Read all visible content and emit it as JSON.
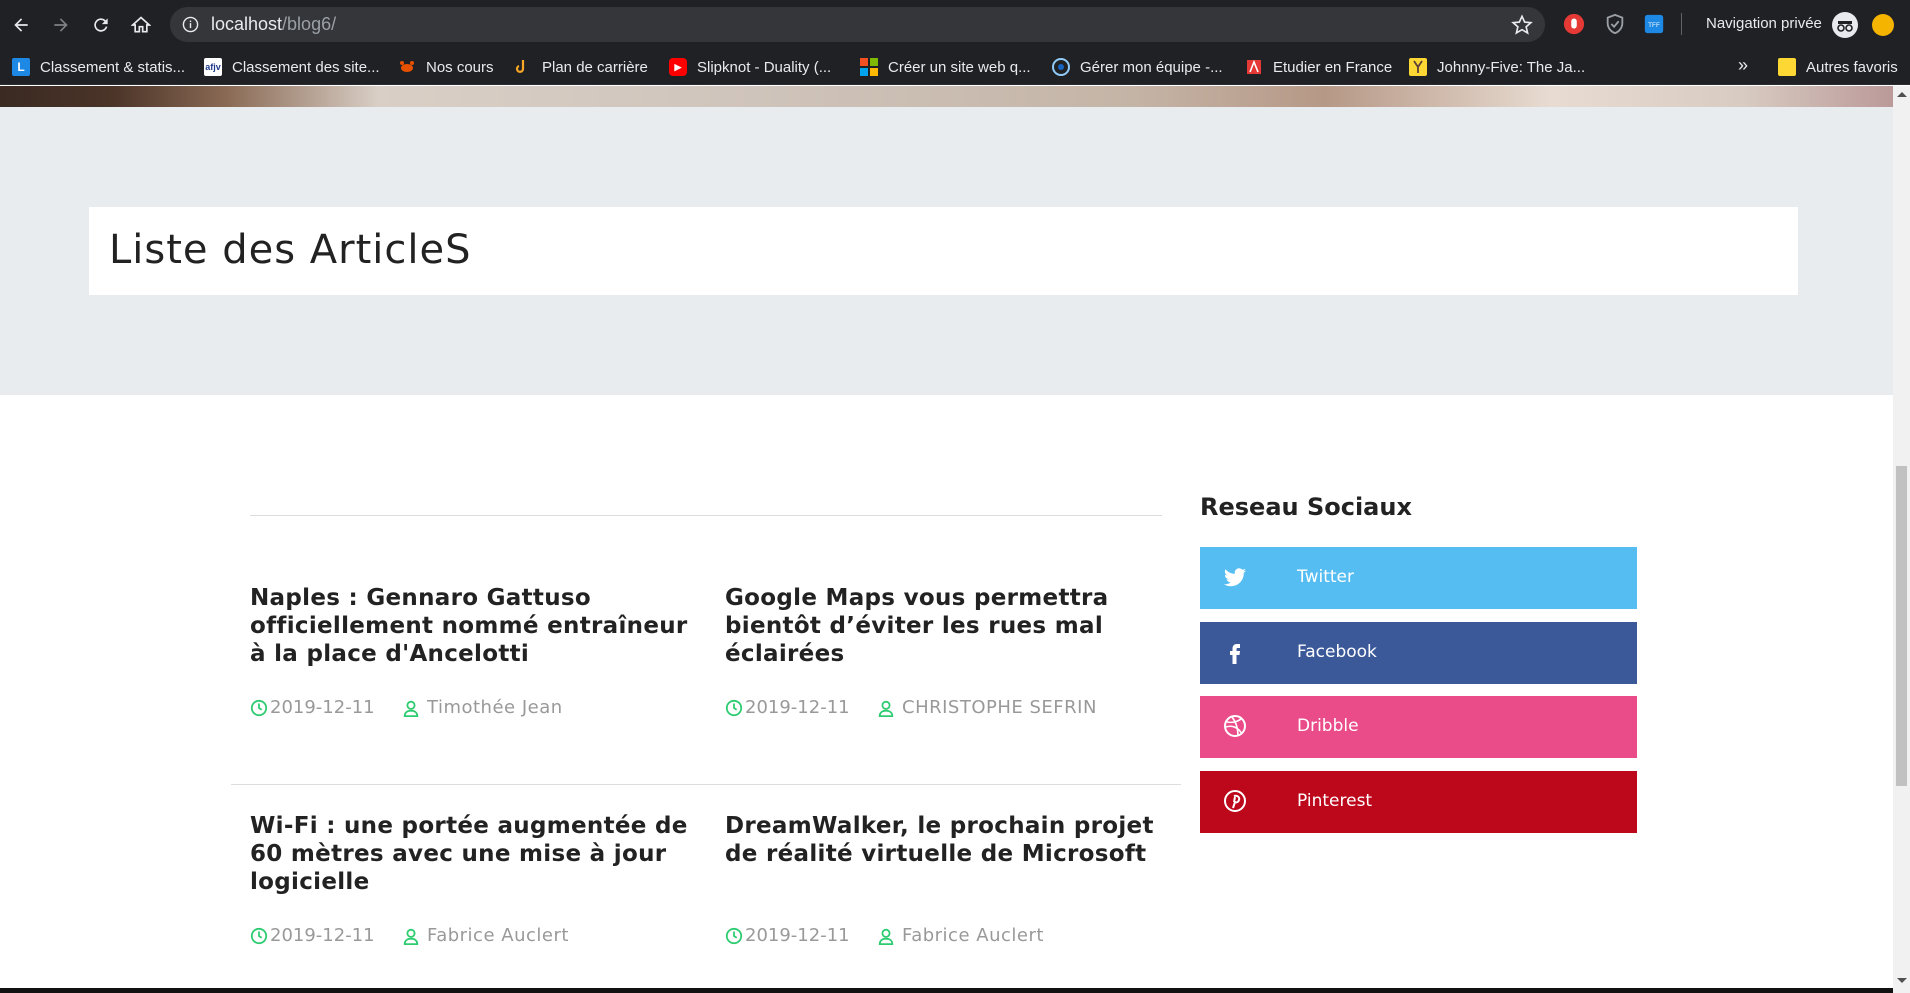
{
  "browser": {
    "url_host": "localhost",
    "url_path": "/blog6/",
    "private_label": "Navigation privée",
    "overflow_label": "»",
    "bookmarks": [
      {
        "label": "Classement & statis...",
        "icon": "letter-l-icon",
        "icon_text": "L",
        "color": "#1e88e5"
      },
      {
        "label": "Classement des site...",
        "icon": "afjv-icon",
        "icon_text": "afjv",
        "color": "#ffffff"
      },
      {
        "label": "Nos cours",
        "icon": "crab-icon",
        "icon_text": "",
        "color": "#e65100"
      },
      {
        "label": "Plan de carrière",
        "icon": "hook-icon",
        "icon_text": "",
        "color": "#f9a825"
      },
      {
        "label": "Slipknot - Duality (...",
        "icon": "youtube-icon",
        "icon_text": "▶",
        "color": "#ff0000"
      },
      {
        "label": "Créer un site web q...",
        "icon": "microsoft-icon",
        "icon_text": "",
        "color": "#f25022"
      },
      {
        "label": "Gérer mon équipe -...",
        "icon": "team-icon",
        "icon_text": "",
        "color": "#1565c0"
      },
      {
        "label": "Etudier en France",
        "icon": "flag-icon",
        "icon_text": "",
        "color": "#e53935"
      },
      {
        "label": "Johnny-Five: The Ja...",
        "icon": "johnny-five-icon",
        "icon_text": "",
        "color": "#fdd835"
      }
    ],
    "other_bookmarks": "Autres favoris"
  },
  "page": {
    "title": "Liste des ArticleS"
  },
  "articles": [
    {
      "title": "Naples : Gennaro Gattuso officiellement nommé entraîneur à la place d'Ancelotti",
      "date": "2019-12-11",
      "author": "Timothée Jean"
    },
    {
      "title": "Google Maps vous permettra bientôt d’éviter les rues mal éclairées",
      "date": "2019-12-11",
      "author": "CHRISTOPHE SEFRIN"
    },
    {
      "title": "Wi-Fi : une portée augmentée de 60 mètres avec une mise à jour logicielle",
      "date": "2019-12-11",
      "author": "Fabrice Auclert"
    },
    {
      "title": "DreamWalker, le prochain projet de réalité virtuelle de Microsoft",
      "date": "2019-12-11",
      "author": "Fabrice Auclert"
    }
  ],
  "sidebar": {
    "title": "Reseau Sociaux",
    "social": [
      {
        "label": "Twitter",
        "icon": "twitter-icon",
        "color": "#55bdf1"
      },
      {
        "label": "Facebook",
        "icon": "facebook-icon",
        "color": "#3b5998"
      },
      {
        "label": "Dribble",
        "icon": "dribbble-icon",
        "color": "#ea4c89"
      },
      {
        "label": "Pinterest",
        "icon": "pinterest-icon",
        "color": "#bd081c"
      }
    ]
  },
  "colors": {
    "accent_green": "#2ecc71",
    "title_band": "#e9ecef"
  }
}
